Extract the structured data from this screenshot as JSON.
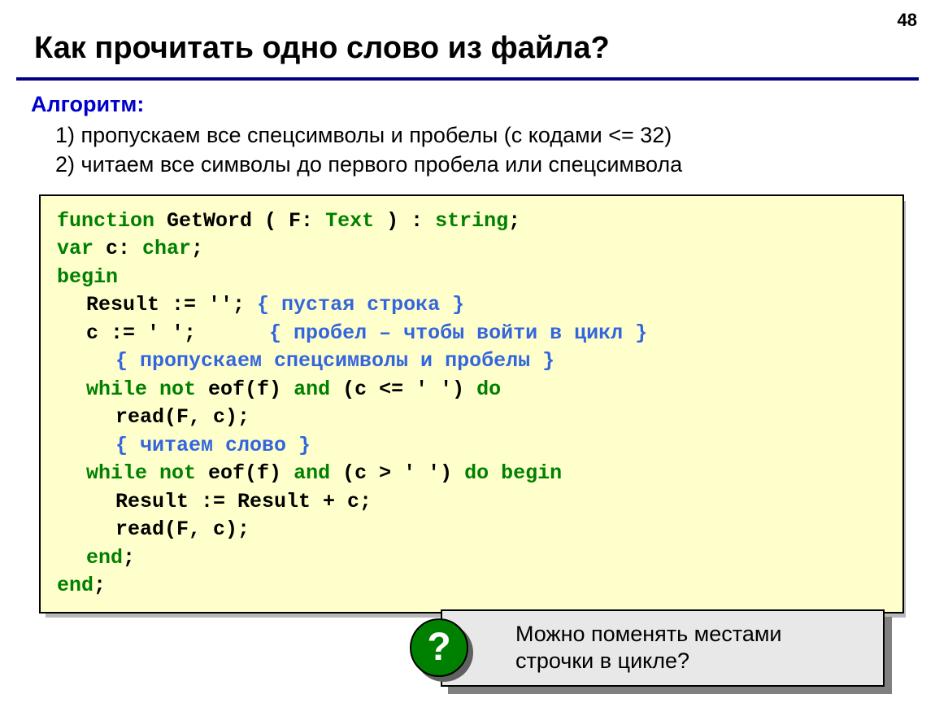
{
  "page_number": "48",
  "title": "Как прочитать одно слово из файла?",
  "algorithm": {
    "heading": "Алгоритм:",
    "steps": [
      "1) пропускаем все спецсимволы и пробелы (с кодами <= 32)",
      "2) читаем все символы до первого пробела или спецсимвола"
    ]
  },
  "code": {
    "l1a": "function",
    "l1b": " GetWord ( F: ",
    "l1c": "Text",
    "l1d": " ) : ",
    "l1e": "string",
    "l1f": ";",
    "l2a": "var",
    "l2b": " c: ",
    "l2c": "char",
    "l2d": ";",
    "l3a": "begin",
    "l4a": "Result := '';",
    "l4b": " { пустая строка }",
    "l5a": "c := ' ';     ",
    "l5b": " { пробел – чтобы войти в цикл }",
    "l6a": "{ пропускаем спецсимволы и пробелы }",
    "l7a": "while not",
    "l7b": " eof(f) ",
    "l7c": "and",
    "l7d": " (c <= ' ') ",
    "l7e": "do",
    "l8a": "read(F, c);",
    "l9a": "{ читаем слово }",
    "l10a": "while not",
    "l10b": " eof(f) ",
    "l10c": "and",
    "l10d": " (c > ' ') ",
    "l10e": "do begin",
    "l11a": "Result := Result + c;",
    "l12a": "read(F, c);",
    "l13a": "end",
    "l13b": ";",
    "l14a": "end",
    "l14b": ";"
  },
  "callout": {
    "question_mark": "?",
    "text_line1": "Можно поменять местами",
    "text_line2": "строчки в цикле?"
  }
}
